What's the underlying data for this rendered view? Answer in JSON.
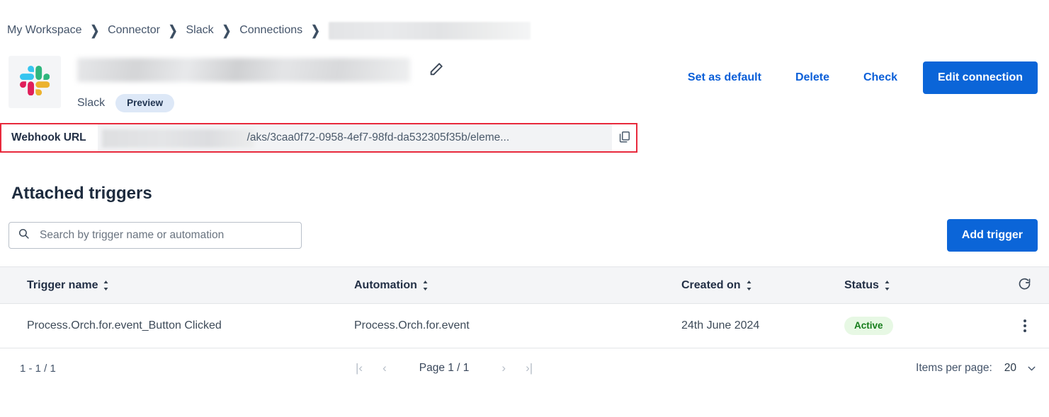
{
  "breadcrumb": {
    "items": [
      {
        "label": "My Workspace"
      },
      {
        "label": "Connector"
      },
      {
        "label": "Slack"
      },
      {
        "label": "Connections"
      }
    ],
    "separator": "❯",
    "redacted_tail": ""
  },
  "header": {
    "app_icon": "slack-logo",
    "title_redacted": "",
    "edit_title_icon": "pencil-icon",
    "app_name": "Slack",
    "badge": "Preview",
    "actions": {
      "set_default": "Set as default",
      "delete": "Delete",
      "check": "Check",
      "edit_connection": "Edit connection"
    }
  },
  "webhook": {
    "label": "Webhook URL",
    "url_visible": "/aks/3caa0f72-0958-4ef7-98fd-da532305f35b/eleme...",
    "copy_icon": "copy-icon",
    "highlight_color": "#e8293c"
  },
  "triggers": {
    "section_title": "Attached triggers",
    "search_placeholder": "Search by trigger name or automation",
    "search_value": "",
    "search_icon": "search-icon",
    "add_button": "Add trigger",
    "refresh_icon": "refresh-icon",
    "columns": [
      {
        "label": "Trigger name"
      },
      {
        "label": "Automation"
      },
      {
        "label": "Created on"
      },
      {
        "label": "Status"
      }
    ],
    "rows": [
      {
        "name": "Process.Orch.for.event_Button Clicked",
        "automation": "Process.Orch.for.event",
        "created_on": "24th June 2024",
        "status": "Active"
      }
    ]
  },
  "pagination": {
    "range": "1 - 1 / 1",
    "first": "|‹",
    "prev": "‹",
    "page_label": "Page 1 / 1",
    "next": "›",
    "last": "›|",
    "items_per_page_label": "Items per page:",
    "items_per_page_value": "20"
  },
  "colors": {
    "accent_blue": "#0b65d8",
    "status_green_text": "#167d1b",
    "status_green_bg": "#e7f8e4",
    "highlight_red": "#e8293c"
  }
}
